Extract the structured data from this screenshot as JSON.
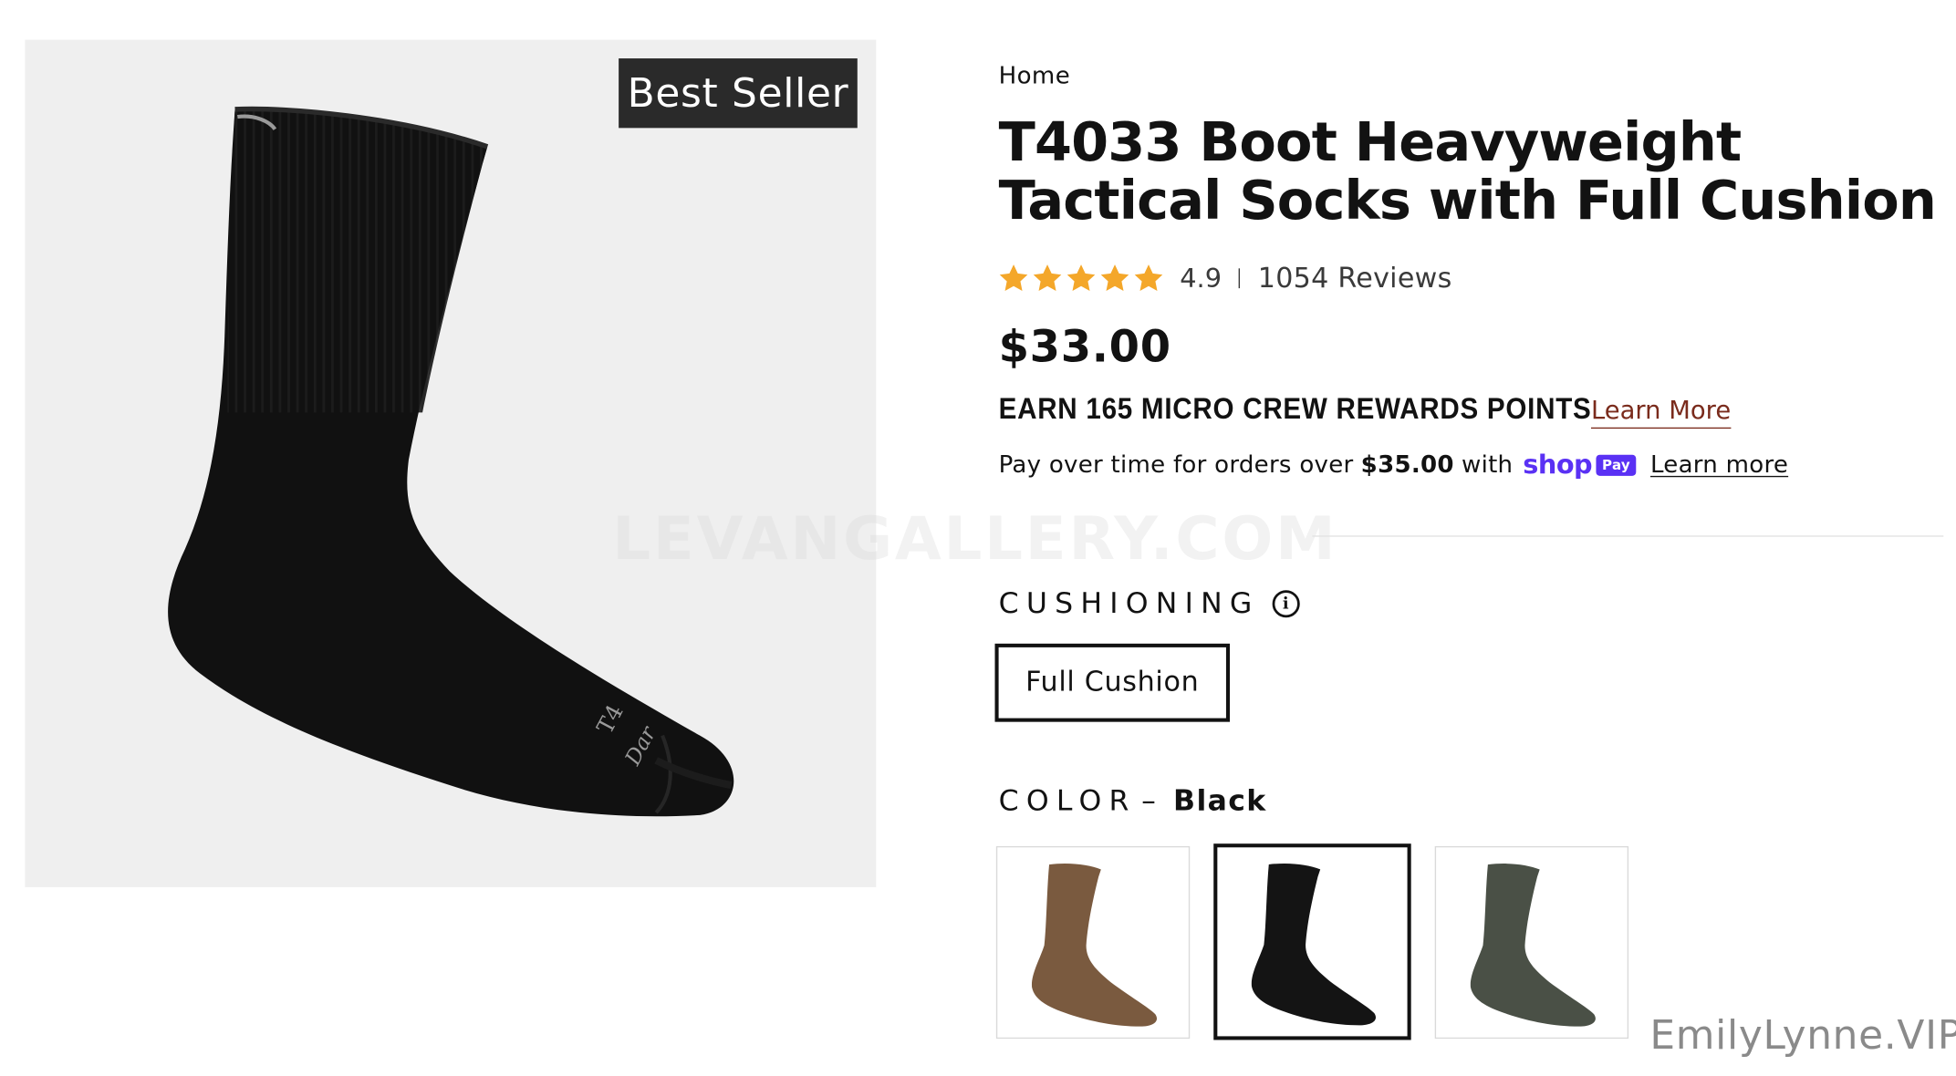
{
  "product_image": {
    "badge": "Best Seller",
    "sock_print_1": "T4",
    "sock_print_2": "Dar"
  },
  "breadcrumb": "Home",
  "product": {
    "title_line1": "T4033 Boot Heavyweight",
    "title_line2": "Tactical Socks with Full Cushion",
    "rating": {
      "stars": 5,
      "value": "4.9",
      "reviews": "1054 Reviews"
    },
    "price": "$33.00",
    "rewards": {
      "text": "EARN 165 MICRO CREW REWARDS POINTS",
      "link": "Learn More"
    },
    "installments": {
      "prefix": "Pay over time for orders over",
      "amount": "$35.00",
      "suffix": "with",
      "shop": "shop",
      "pay": "Pay",
      "link": "Learn more"
    }
  },
  "watermark": "LEVANGALLERY.COM",
  "options": {
    "cushioning": {
      "label": "CUSHIONING",
      "info_glyph": "i",
      "selected": "Full Cushion"
    },
    "color": {
      "label": "COLOR",
      "separator": "–",
      "selected": "Black",
      "swatches": [
        {
          "name": "Coyote",
          "color": "#7a5a3f",
          "selected": false
        },
        {
          "name": "Black",
          "color": "#141414",
          "selected": true
        },
        {
          "name": "Olive",
          "color": "#4a5046",
          "selected": false
        }
      ]
    }
  },
  "credit": "EmilyLynne.VIP",
  "colors": {
    "star": "#f4a72a",
    "shop_purple": "#5a31f4",
    "rewards_link": "#7a2b1c",
    "sock": "#121212",
    "image_bg": "#efefef"
  }
}
